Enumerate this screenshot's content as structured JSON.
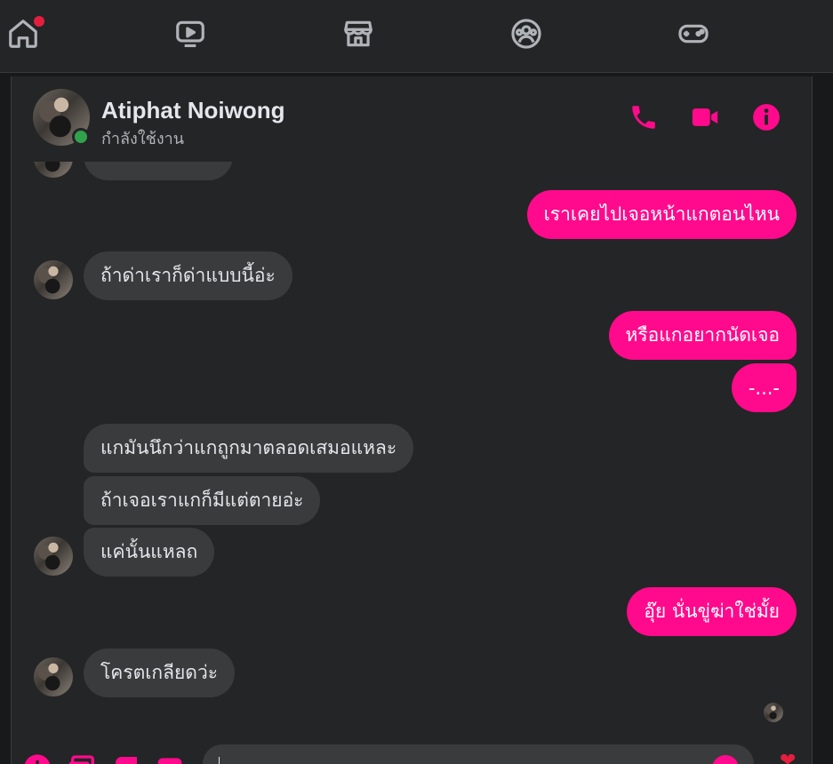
{
  "nav": {
    "items": [
      {
        "name": "home",
        "label": "Home"
      },
      {
        "name": "watch",
        "label": "Watch"
      },
      {
        "name": "marketplace",
        "label": "Marketplace"
      },
      {
        "name": "groups",
        "label": "Groups"
      },
      {
        "name": "gaming",
        "label": "Gaming"
      }
    ]
  },
  "header": {
    "contact_name": "Atiphat Noiwong",
    "status": "กำลังใช้งาน"
  },
  "messages": [
    {
      "dir": "out",
      "text": "เราเคยไปเจอหน้าแกตอนไหน"
    },
    {
      "dir": "in",
      "text": "ถ้าด่าเราก็ด่าแบบนี้อ่ะ"
    },
    {
      "dir": "out",
      "text": "หรือแกอยากนัดเจอ"
    },
    {
      "dir": "out",
      "text": "-...-"
    },
    {
      "dir": "in",
      "text": "แกมันนึกว่าแกถูกมาตลอดเสมอแหละ"
    },
    {
      "dir": "in",
      "text": "ถ้าเจอเราแกก็มีแต่ตายอ่ะ"
    },
    {
      "dir": "in",
      "text": "แค่นั้นแหลถ"
    },
    {
      "dir": "out",
      "text": "อุ๊ย นั่นขู่ฆ่าใช่มั้ย"
    },
    {
      "dir": "in",
      "text": "โครตเกลียดว่ะ"
    }
  ],
  "colors": {
    "accent": "#ff0a8c",
    "online": "#31a24c",
    "notification": "#e41e3f",
    "incoming_bubble": "#3a3b3c",
    "panel": "#242526"
  }
}
